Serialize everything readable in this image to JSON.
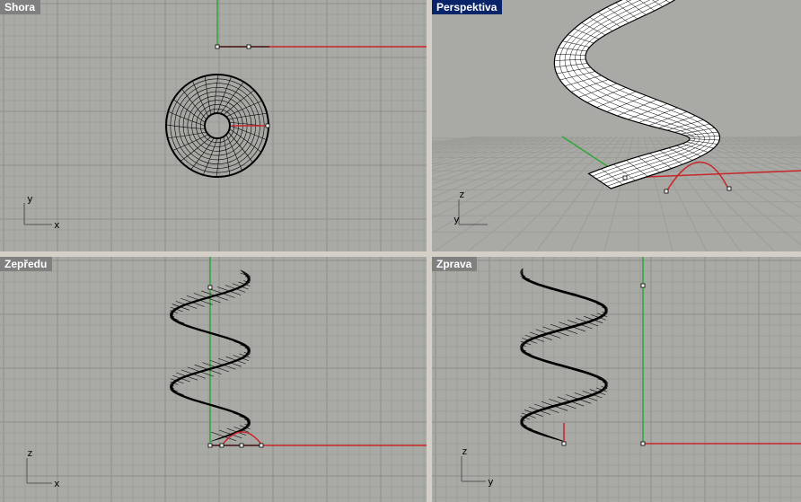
{
  "viewports": {
    "top": {
      "title": "Shora",
      "axis_h": "x",
      "axis_v": "y"
    },
    "perspective": {
      "title": "Perspektiva",
      "axis_h": "y",
      "axis_v": "z"
    },
    "front": {
      "title": "Zepředu",
      "axis_h": "x",
      "axis_v": "z"
    },
    "right": {
      "title": "Zprava",
      "axis_h": "y",
      "axis_v": "z"
    }
  },
  "colors": {
    "viewport_bg": "#a9aaa5",
    "grid": "#9c9d98",
    "grid_major": "#8d8e89",
    "x_axis": "#c8262a",
    "y_axis": "#2ea63a",
    "active_title_bg": "#0a246a",
    "title_bg": "#808080",
    "wireframe": "#000000"
  },
  "active_viewport": "perspective"
}
